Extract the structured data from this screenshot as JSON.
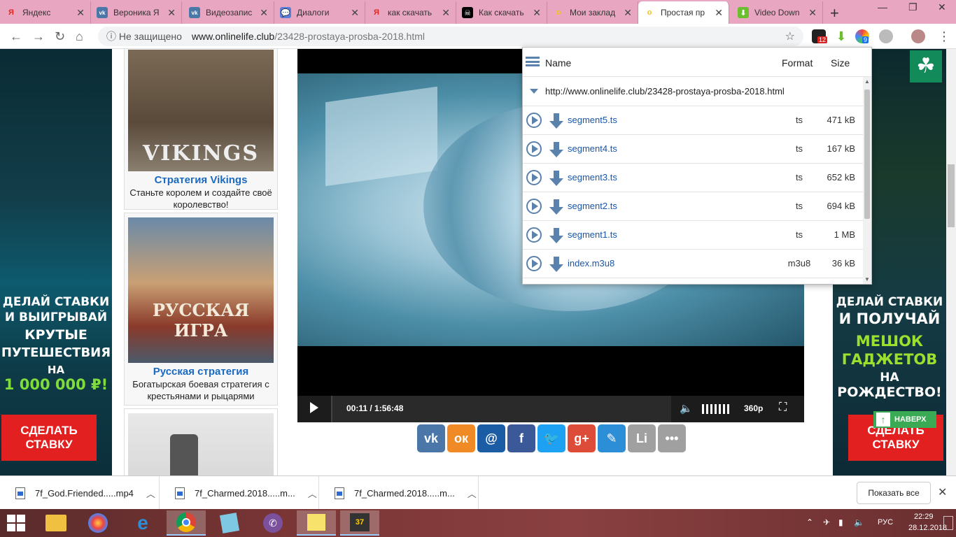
{
  "tabs": [
    {
      "title": "Яндекс",
      "fav": "Я",
      "color": "#e52620",
      "fg": "#e52620"
    },
    {
      "title": "Вероника Я",
      "fav": "vk",
      "color": "#4a76a8",
      "fg": "#fff"
    },
    {
      "title": "Видеозапис",
      "fav": "vk",
      "color": "#4a76a8",
      "fg": "#fff"
    },
    {
      "title": "Диалоги",
      "fav": "💬",
      "color": "#5b7fd8",
      "fg": "#fff"
    },
    {
      "title": "как скачать",
      "fav": "Я",
      "color": "#e52620",
      "fg": "#e52620"
    },
    {
      "title": "Как скачать",
      "fav": "☠",
      "color": "#000",
      "fg": "#fff"
    },
    {
      "title": "Мои заклад",
      "fav": "o",
      "color": "#f5c518",
      "fg": "#f5c518"
    },
    {
      "title": "Простая пр",
      "fav": "o",
      "color": "#f5c518",
      "fg": "#f5c518",
      "active": true
    },
    {
      "title": "Video Down",
      "fav": "⬇",
      "color": "#6bbf2f",
      "fg": "#fff"
    }
  ],
  "toolbar": {
    "security": "ⓘ Не защищено",
    "host": "www.onlinelife.club",
    "path": "/23428-prostaya-prosba-2018.html",
    "ext_badge_1": "12",
    "ext_badge_2": "9"
  },
  "left_ad": {
    "line1": "ДЕЛАЙ СТАВКИ",
    "line2": "И ВЫИГРЫВАЙ",
    "line3": "КРУТЫЕ",
    "line4": "ПУТЕШЕСТВИЯ",
    "line5": "НА",
    "line6": "1 000 000 ₽!",
    "button": "СДЕЛАТЬ\nСТАВКУ"
  },
  "right_ad": {
    "line1": "ДЕЛАЙ СТАВКИ",
    "line2": "И ПОЛУЧАЙ",
    "line3": "МЕШОК",
    "line4": "ГАДЖЕТОВ",
    "line5": "НА",
    "line6": "РОЖДЕСТВО!",
    "button": "СДЕЛАТЬ\nСТАВКУ",
    "to_top": "НАВЕРХ"
  },
  "cards": [
    {
      "image_text": "VIKINGS",
      "title": "Стратегия Vikings",
      "desc": "Станьте королем и создайте своё королевство!"
    },
    {
      "image_text": "РУССКАЯ ИГРА",
      "title": "Русская стратегия",
      "desc": "Богатырская боевая стратегия с крестьянами и рыцарями"
    }
  ],
  "player": {
    "time": "00:11 / 1:56:48",
    "quality": "360p",
    "volume_pct": 100
  },
  "share": [
    {
      "name": "vk",
      "label": "vk",
      "color": "#4a76a8"
    },
    {
      "name": "odnoklassniki",
      "label": "ок",
      "color": "#f08a24"
    },
    {
      "name": "mailru",
      "label": "@",
      "color": "#1a5da5"
    },
    {
      "name": "facebook",
      "label": "f",
      "color": "#3b5998"
    },
    {
      "name": "twitter",
      "label": "🐦",
      "color": "#1da1f2"
    },
    {
      "name": "googleplus",
      "label": "g+",
      "color": "#dd4b39"
    },
    {
      "name": "livejournal",
      "label": "✎",
      "color": "#2d8ed8"
    },
    {
      "name": "liveinternet",
      "label": "Li",
      "color": "#a0a0a0"
    },
    {
      "name": "more",
      "label": "•••",
      "color": "#a0a0a0"
    }
  ],
  "popup": {
    "col_name": "Name",
    "col_format": "Format",
    "col_size": "Size",
    "url": "http://www.onlinelife.club/23428-prostaya-prosba-2018.html",
    "rows": [
      {
        "name": "segment5.ts",
        "format": "ts",
        "size": "471 kB"
      },
      {
        "name": "segment4.ts",
        "format": "ts",
        "size": "167 kB"
      },
      {
        "name": "segment3.ts",
        "format": "ts",
        "size": "652 kB"
      },
      {
        "name": "segment2.ts",
        "format": "ts",
        "size": "694 kB"
      },
      {
        "name": "segment1.ts",
        "format": "ts",
        "size": "1 MB"
      },
      {
        "name": "index.m3u8",
        "format": "m3u8",
        "size": "36 kB"
      }
    ]
  },
  "downloads": {
    "items": [
      "7f_God.Friended.....mp4",
      "7f_Charmed.2018.....m...",
      "7f_Charmed.2018.....m..."
    ],
    "show_all": "Показать все"
  },
  "taskbar": {
    "lang": "РУС",
    "time": "22:29",
    "date": "28.12.2018"
  }
}
